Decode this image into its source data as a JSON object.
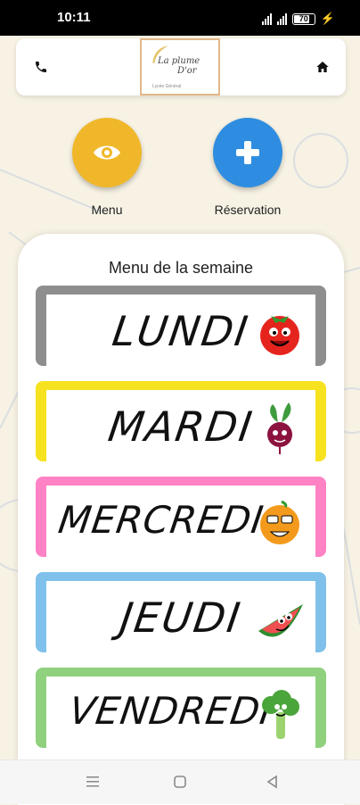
{
  "status_bar": {
    "time": "10:11",
    "battery": "70"
  },
  "header": {
    "phone_icon": "phone-icon",
    "home_icon": "home-icon",
    "logo_line1": "La plume",
    "logo_line2": "D'or",
    "logo_sub": "Lycée Général"
  },
  "actions": [
    {
      "label": "Menu",
      "icon": "eye-icon",
      "color": "#f0b72a"
    },
    {
      "label": "Réservation",
      "icon": "plus-icon",
      "color": "#2e8de0"
    }
  ],
  "week": {
    "title": "Menu de la semaine",
    "days": [
      {
        "name": "LUNDI",
        "color": "#8e8e8e",
        "mascot": "tomato-icon"
      },
      {
        "name": "MARDI",
        "color": "#f7e21f",
        "mascot": "beet-icon"
      },
      {
        "name": "MERCREDI",
        "color": "#ff82c4",
        "mascot": "orange-icon"
      },
      {
        "name": "JEUDI",
        "color": "#7fc1ea",
        "mascot": "watermelon-icon"
      },
      {
        "name": "VENDREDI",
        "color": "#8fd17d",
        "mascot": "broccoli-icon"
      }
    ]
  },
  "nav": {
    "menu_icon": "menu-lines-icon",
    "home_icon": "square-home-icon",
    "back_icon": "back-triangle-icon"
  }
}
